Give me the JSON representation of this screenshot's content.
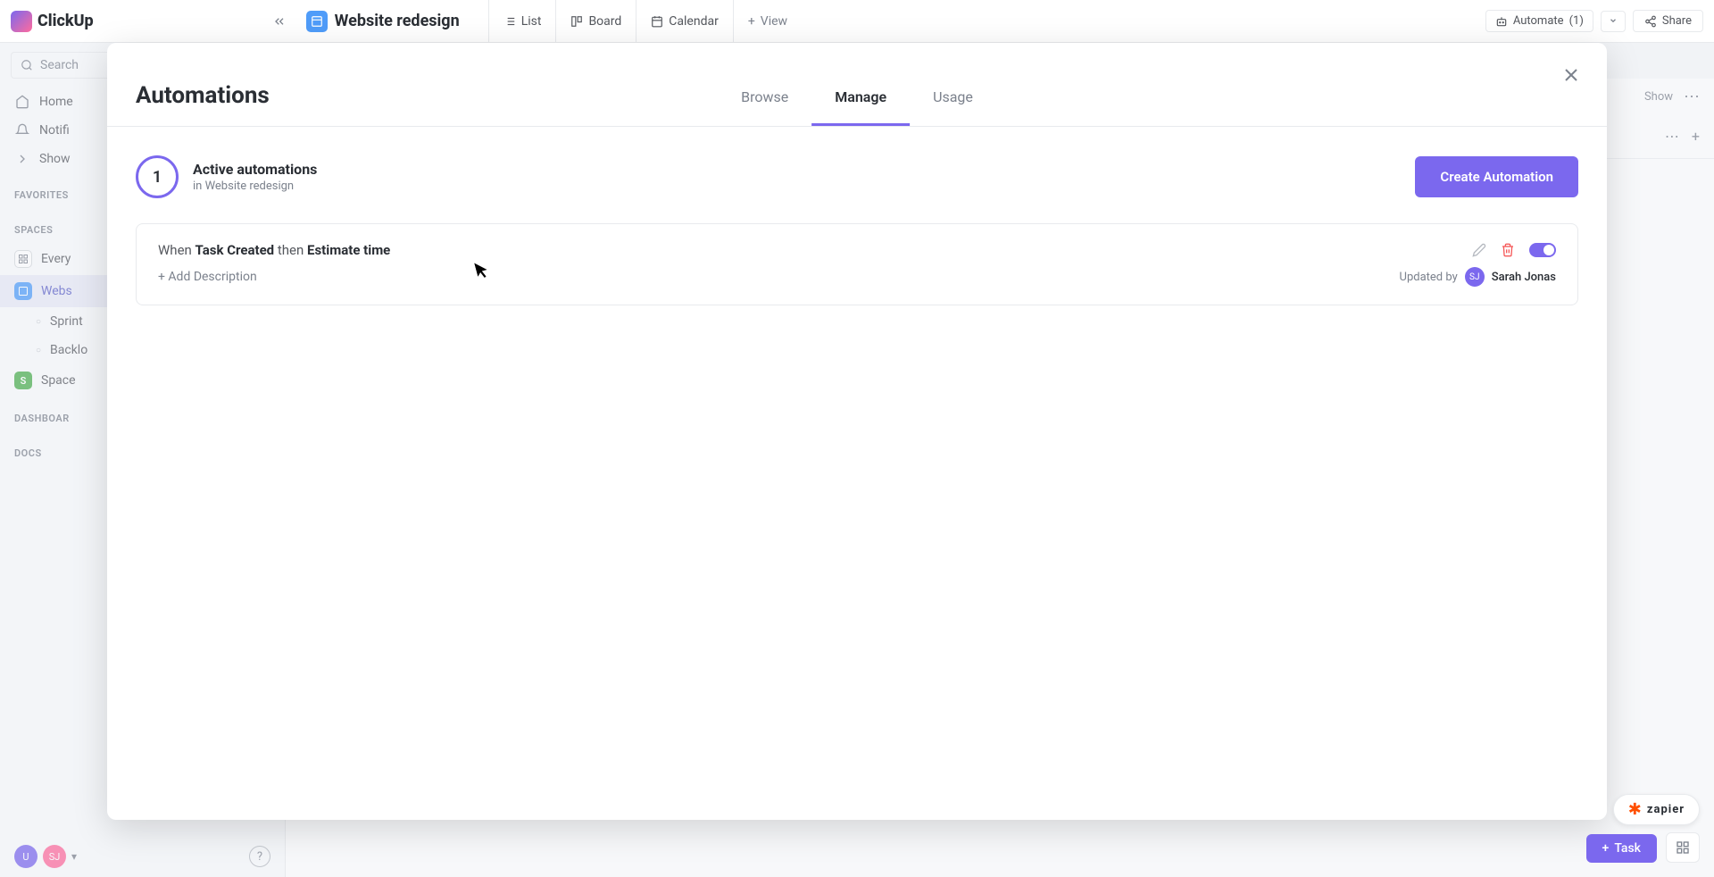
{
  "app": {
    "name": "ClickUp"
  },
  "topbar": {
    "workspace_title": "Website redesign",
    "views": {
      "list": "List",
      "board": "Board",
      "calendar": "Calendar",
      "view_btn": "View"
    },
    "automate_label": "Automate",
    "automate_count": "(1)",
    "share_label": "Share"
  },
  "sidebar": {
    "search_placeholder": "Search",
    "nav": {
      "home": "Home",
      "notifications": "Notifi",
      "show": "Show"
    },
    "sections": {
      "favorites": "FAVORITES",
      "spaces": "SPACES",
      "dashboards": "DASHBOAR",
      "docs": "DOCS"
    },
    "spaces": {
      "everything": "Every",
      "website": "Webs",
      "sprint": "Sprint",
      "backlog": "Backlo",
      "space": "Space"
    },
    "avatars": {
      "u": "U",
      "sj": "SJ"
    }
  },
  "gantt": {
    "show": "Show"
  },
  "modal": {
    "title": "Automations",
    "tabs": {
      "browse": "Browse",
      "manage": "Manage",
      "usage": "Usage"
    },
    "summary_count": "1",
    "summary_title": "Active automations",
    "summary_sub_prefix": "in",
    "summary_sub_name": "Website redesign",
    "create_btn": "Create Automation",
    "automation": {
      "when": "When",
      "trigger": "Task Created",
      "then": "then",
      "action": "Estimate time",
      "add_description": "+ Add Description",
      "updated_by_label": "Updated by",
      "avatar_initials": "SJ",
      "updated_by_name": "Sarah Jonas"
    }
  },
  "floating": {
    "zapier": "zapier",
    "task": "Task"
  }
}
